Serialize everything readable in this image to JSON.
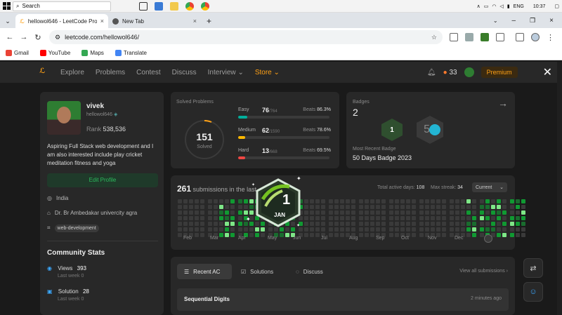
{
  "taskbar": {
    "search_label": "Search",
    "tray": {
      "lang": "ENG",
      "time": "10:37"
    }
  },
  "browser": {
    "tabs": [
      {
        "title": "hellowol646 - LeetCode Profile",
        "active": true
      },
      {
        "title": "New Tab",
        "active": false
      }
    ],
    "url": "leetcode.com/hellowol646/",
    "bookmarks": [
      "Gmail",
      "YouTube",
      "Maps",
      "Translate"
    ]
  },
  "lcnav": {
    "items": [
      "Explore",
      "Problems",
      "Contest",
      "Discuss",
      "Interview",
      "Store"
    ],
    "streak": "33",
    "premium": "Premium"
  },
  "profile": {
    "name": "vivek",
    "username": "hellowol646",
    "rank_label": "Rank",
    "rank": "538,536",
    "bio": "Aspiring Full Stack web development and I am also interested include play cricket meditation fitness and yoga",
    "edit_label": "Edit Profile",
    "location": "India",
    "school": "Dr. Br Ambedakar univercity agra",
    "skill": "web-development"
  },
  "community": {
    "title": "Community Stats",
    "views_label": "Views",
    "views": "393",
    "views_sub": "Last week 0",
    "solution_label": "Solution",
    "solution": "28",
    "solution_sub": "Last week 0"
  },
  "solved": {
    "title": "Solved Problems",
    "total": "151",
    "total_label": "Solved",
    "rows": [
      {
        "label": "Easy",
        "count": "76",
        "total": "/764",
        "beats": "86.3%",
        "fraction": 0.0995,
        "color": "#00af9b"
      },
      {
        "label": "Medium",
        "count": "62",
        "total": "/1590",
        "beats": "78.6%",
        "fraction": 0.039,
        "color": "#ffb800"
      },
      {
        "label": "Hard",
        "count": "13",
        "total": "/668",
        "beats": "69.5%",
        "fraction": 0.0195,
        "color": "#ef4743"
      }
    ],
    "beats_label": "Beats"
  },
  "badges": {
    "title": "Badges",
    "count": "2",
    "recent_label": "Most Recent Badge",
    "recent": "50 Days Badge 2023",
    "badge_text_1": "1",
    "badge_text_2": "50"
  },
  "submissions": {
    "count": "261",
    "text": "submissions in the last",
    "active_days_label": "Total active days:",
    "active_days": "108",
    "max_streak_label": "Max streak:",
    "max_streak": "34",
    "range": "Current",
    "months": [
      "Feb",
      "Mar",
      "Apr",
      "May",
      "Jun",
      "Jul",
      "Aug",
      "Sep",
      "Oct",
      "Nov",
      "Dec"
    ]
  },
  "popup_badge": {
    "number": "1",
    "month": "JAN"
  },
  "recent": {
    "tabs": [
      "Recent AC",
      "Solutions",
      "Discuss"
    ],
    "view_all": "View all submissions",
    "items": [
      {
        "title": "Sequential Digits",
        "time": "2 minutes ago"
      }
    ]
  },
  "colors": {
    "accent": "#ffa116",
    "green": "#2cbb5d",
    "bg": "#1a1a1a",
    "card": "#282828"
  }
}
